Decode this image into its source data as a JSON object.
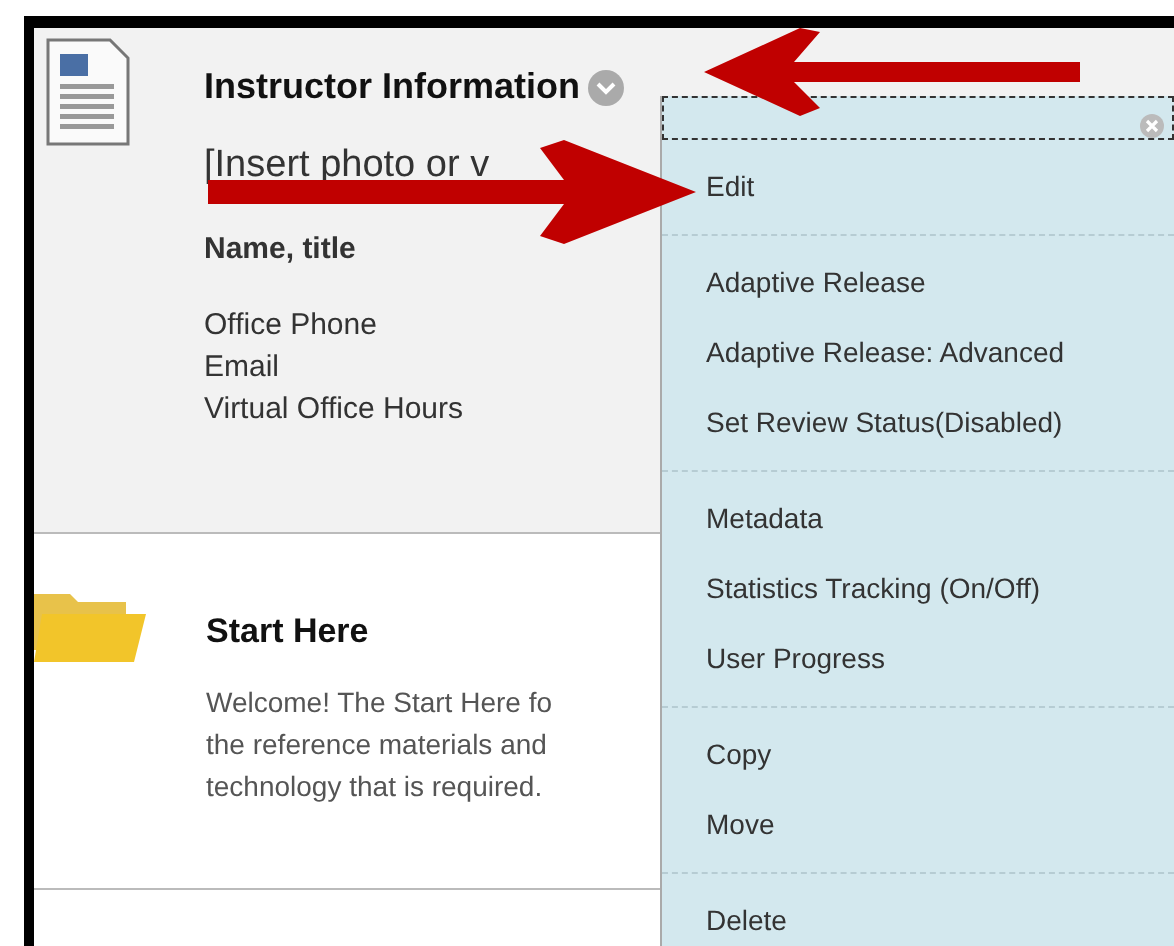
{
  "items": [
    {
      "kind": "document",
      "title": "Instructor Information",
      "lines": [
        {
          "kind": "large",
          "text": "[Insert photo or v"
        },
        {
          "kind": "bold",
          "text": "Name, title"
        },
        {
          "kind": "plain",
          "text": "Office Phone"
        },
        {
          "kind": "plain",
          "text": "Email"
        },
        {
          "kind": "plain",
          "text": "Virtual Office Hours"
        }
      ],
      "selected": true
    },
    {
      "kind": "folder",
      "title": "Start Here",
      "lines": [
        {
          "kind": "muted",
          "text": "Welcome! The Start Here fo"
        },
        {
          "kind": "muted",
          "text": "the reference materials and"
        },
        {
          "kind": "muted",
          "text": "technology that is required."
        }
      ],
      "selected": false
    }
  ],
  "menu": {
    "groups": [
      [
        "Edit"
      ],
      [
        "Adaptive Release",
        "Adaptive Release: Advanced",
        "Set Review Status(Disabled)"
      ],
      [
        "Metadata",
        "Statistics Tracking (On/Off)",
        "User Progress"
      ],
      [
        "Copy",
        "Move"
      ],
      [
        "Delete"
      ]
    ]
  }
}
